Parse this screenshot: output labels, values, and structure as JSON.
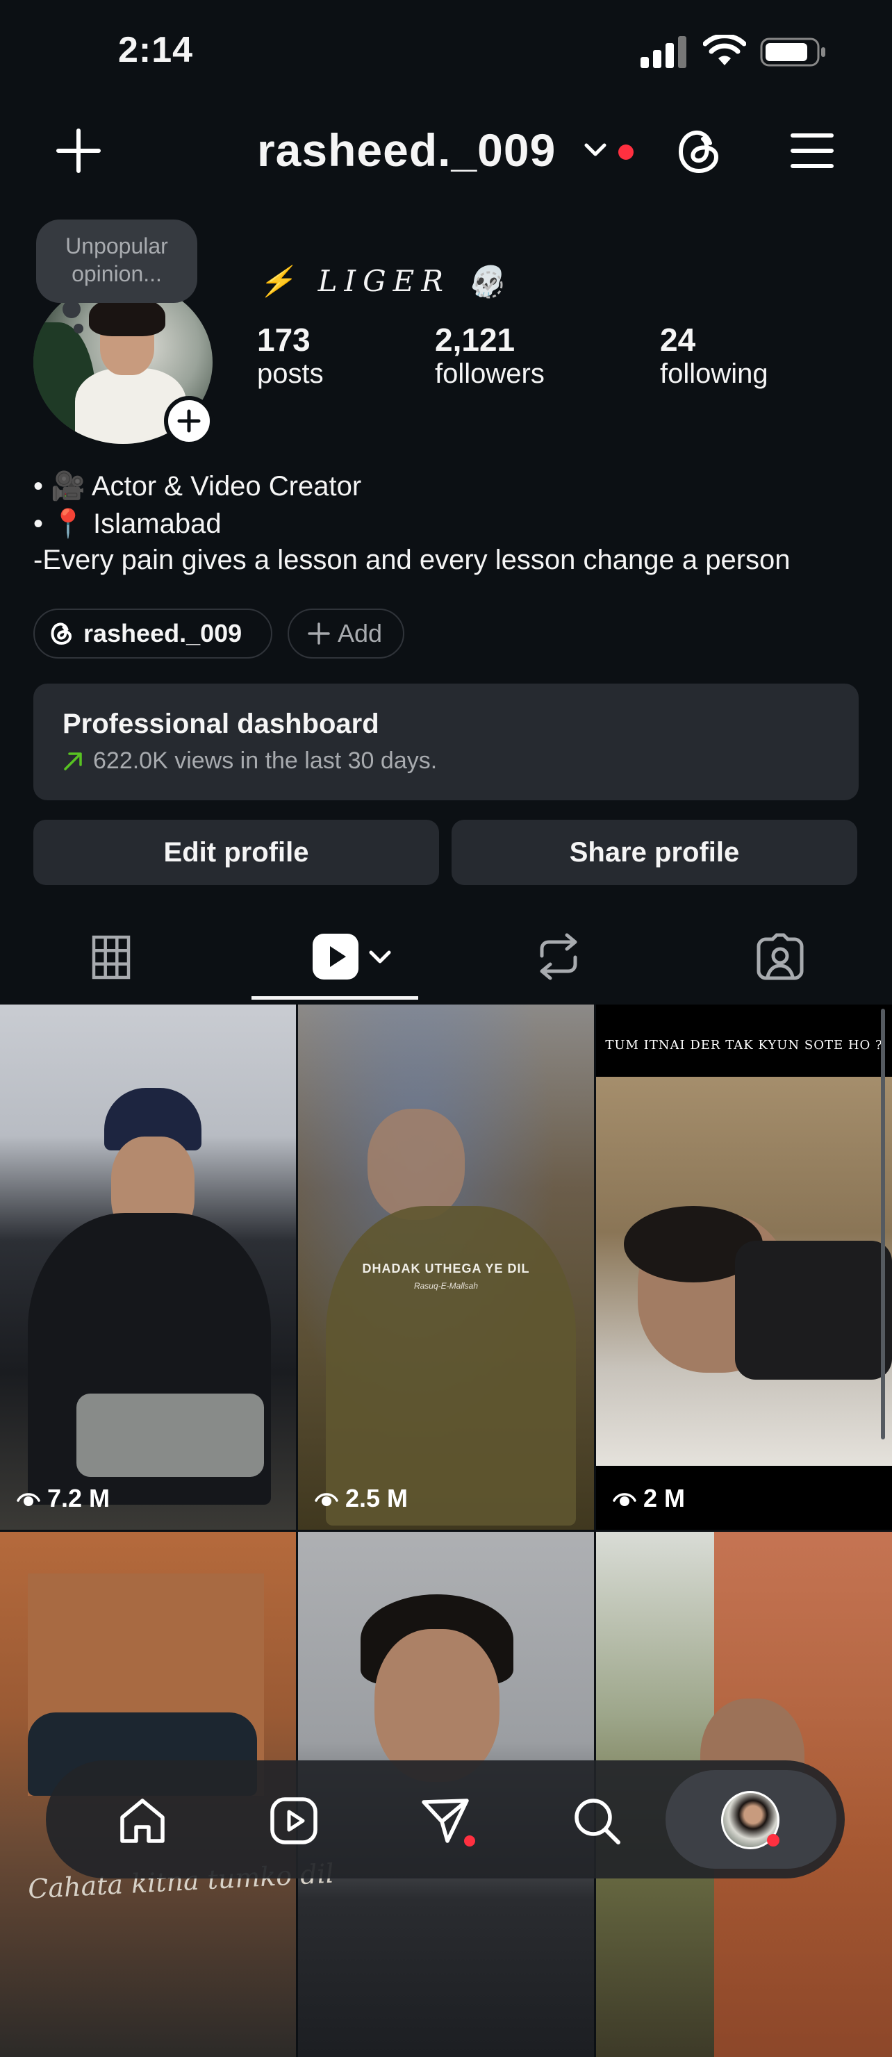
{
  "status_bar": {
    "time": "2:14"
  },
  "header": {
    "username": "rasheed._009"
  },
  "profile": {
    "note": "Unpopular opinion...",
    "display_name": "⚡ LIGER 💀",
    "stats": [
      {
        "value": "173",
        "label": "posts"
      },
      {
        "value": "2,121",
        "label": "followers"
      },
      {
        "value": "24",
        "label": "following"
      }
    ],
    "bio": [
      "• 🎥 Actor & Video Creator",
      "• 📍 Islamabad",
      "-Every pain gives a lesson and every lesson change a person"
    ],
    "threads_handle": "rasheed._009",
    "add_label": "Add"
  },
  "dashboard": {
    "title": "Professional dashboard",
    "subtitle": "622.0K views in the last 30 days."
  },
  "actions": {
    "edit": "Edit profile",
    "share": "Share profile"
  },
  "grid": [
    {
      "views": "7.2 M"
    },
    {
      "views": "2.5 M",
      "overlay_title": "DHADAK UTHEGA YE DIL",
      "overlay_sub": "Rasuq-E-Mallsah"
    },
    {
      "views": "2 M",
      "overlay_title": "TUM ITNAI DER TAK KYUN SOTE HO ?"
    },
    {
      "views": ""
    },
    {
      "views": ""
    },
    {
      "views": ""
    }
  ],
  "grid_caption": "Cahata kitna tumko dil",
  "colors": {
    "background": "#0c1014",
    "card": "#262a30",
    "accent_red": "#ff3040",
    "trend_green": "#58c322"
  }
}
